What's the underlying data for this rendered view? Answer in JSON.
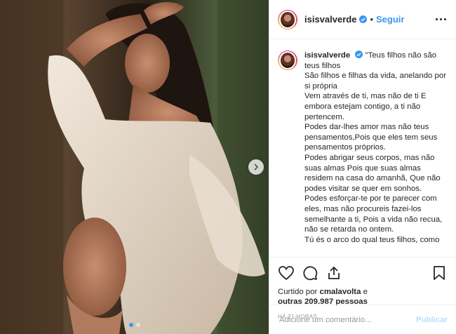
{
  "post": {
    "username": "isisvalverde",
    "verified": true,
    "follow_label": "Seguir",
    "more_icon": "more-options-icon",
    "separator": "•"
  },
  "caption": {
    "username": "isisvalverde",
    "lines": [
      "\"Teus filhos não são teus filhos",
      "São filhos e filhas da vida, anelando por si própria",
      "Vem através de ti, mas não de ti E embora estejam contigo, a ti não pertencem.",
      "Podes dar-lhes amor mas não teus pensamentos,Pois que eles tem seus pensamentos próprios.",
      "Podes abrigar seus corpos, mas não suas almas Pois que suas almas residem na casa do amanhã, Que não podes visitar se quer em sonhos.",
      "Podes esforçar-te por te parecer com eles, mas não procureis fazei-los semelhante a ti, Pois a vida não recua, não se retarda no ontem.",
      "Tú és o arco do qual teus filhos, como"
    ]
  },
  "actions": {
    "icons": [
      "heart-icon",
      "comment-icon",
      "share-icon",
      "bookmark-icon"
    ],
    "liked_prefix": "Curtido por",
    "liked_user": "cmalavolta",
    "liked_mid": "e",
    "liked_others": "outras 209.987 pessoas",
    "time": "HÁ 21 HORAS"
  },
  "comment_box": {
    "placeholder": "Adicione um comentário...",
    "publish_label": "Publicar"
  },
  "carousel": {
    "dot_count": 2,
    "active_index": 0
  },
  "colors": {
    "accent": "#3897f0",
    "publish_disabled": "#b2dffc",
    "text": "#262626",
    "muted": "#999999"
  }
}
